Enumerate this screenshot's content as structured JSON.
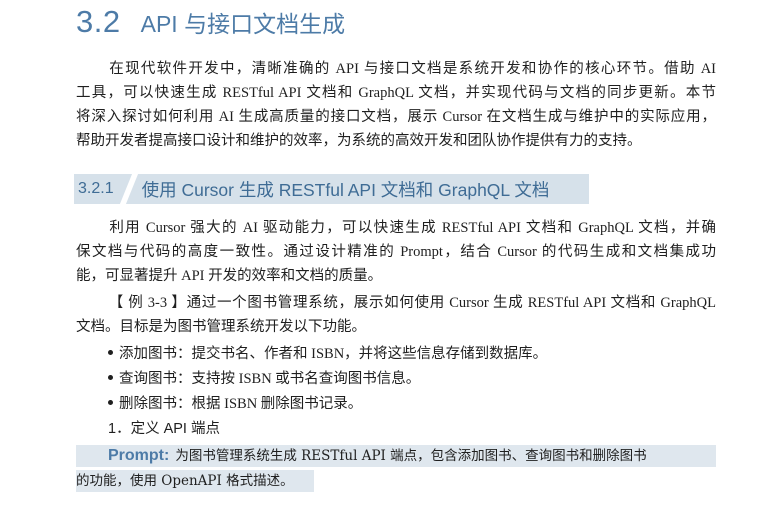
{
  "section": {
    "number": "3.2",
    "title": "API 与接口文档生成"
  },
  "intro": [
    "在现代软件开发中，清晰准确的 API 与接口文档是系统开发和协作的核心环节。借助 AI",
    "工具，可以快速生成 RESTful API 文档和 GraphQL 文档，并实现代码与文档的同步更新。本节",
    "将深入探讨如何利用 AI 生成高质量的接口文档，展示 Cursor 在文档生成与维护中的实际应用，",
    "帮助开发者提高接口设计和维护的效率，为系统的高效开发和团队协作提供有力的支持。"
  ],
  "subsection": {
    "number": "3.2.1",
    "title": "使用 Cursor 生成 RESTful API 文档和 GraphQL 文档"
  },
  "para2": [
    "利用 Cursor 强大的 AI 驱动能力，可以快速生成 RESTful API 文档和 GraphQL 文档，并确",
    "保文档与代码的高度一致性。通过设计精准的 Prompt，结合 Cursor 的代码生成和文档集成功",
    "能，可显著提升 API 开发的效率和文档的质量。"
  ],
  "example": [
    "【 例 3-3 】通过一个图书管理系统，展示如何使用 Cursor 生成 RESTful API 文档和 GraphQL",
    "文档。目标是为图书管理系统开发以下功能。"
  ],
  "bullets": [
    "添加图书：提交书名、作者和 ISBN，并将这些信息存储到数据库。",
    "查询图书：支持按 ISBN 或书名查询图书信息。",
    "删除图书：根据 ISBN 删除图书记录。"
  ],
  "step": "1．定义 API 端点",
  "prompt": {
    "label": "Prompt:",
    "line1": "为图书管理系统生成 RESTful API 端点，包含添加图书、查询图书和删除图书",
    "line2": "的功能，使用 OpenAPI 格式描述。"
  }
}
